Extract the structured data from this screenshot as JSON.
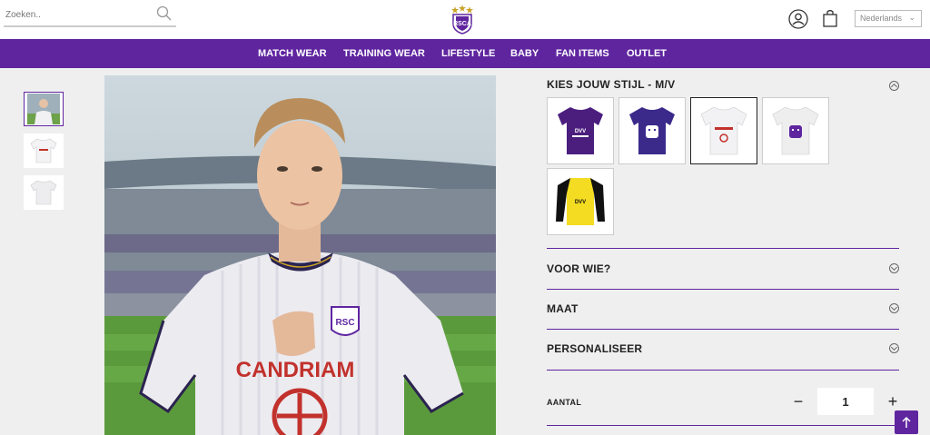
{
  "header": {
    "search_placeholder": "Zoeken..",
    "language": "Nederlands"
  },
  "nav": {
    "items": [
      "MATCH WEAR",
      "TRAINING WEAR",
      "LIFESTYLE",
      "BABY",
      "FAN ITEMS",
      "OUTLET"
    ]
  },
  "product": {
    "style_title": "KIES JOUW STIJL - M/V",
    "swatches": [
      {
        "name": "purple-sponsor-shirt",
        "color": "#4b1e7e"
      },
      {
        "name": "purple-logo-shirt",
        "color": "#3b2a8a"
      },
      {
        "name": "white-sponsor-shirt",
        "color": "#f2f2f4"
      },
      {
        "name": "white-logo-shirt",
        "color": "#eeeeef"
      },
      {
        "name": "yellow-keeper-shirt",
        "color": "#f3dc22"
      }
    ],
    "sections": [
      "VOOR WIE?",
      "MAAT",
      "PERSONALISEER"
    ],
    "quantity_label": "AANTAL",
    "quantity_value": "1",
    "shirt_text": "CANDRIAM"
  },
  "colors": {
    "brand_purple": "#5f259f",
    "shirt_red": "#c2312c"
  }
}
